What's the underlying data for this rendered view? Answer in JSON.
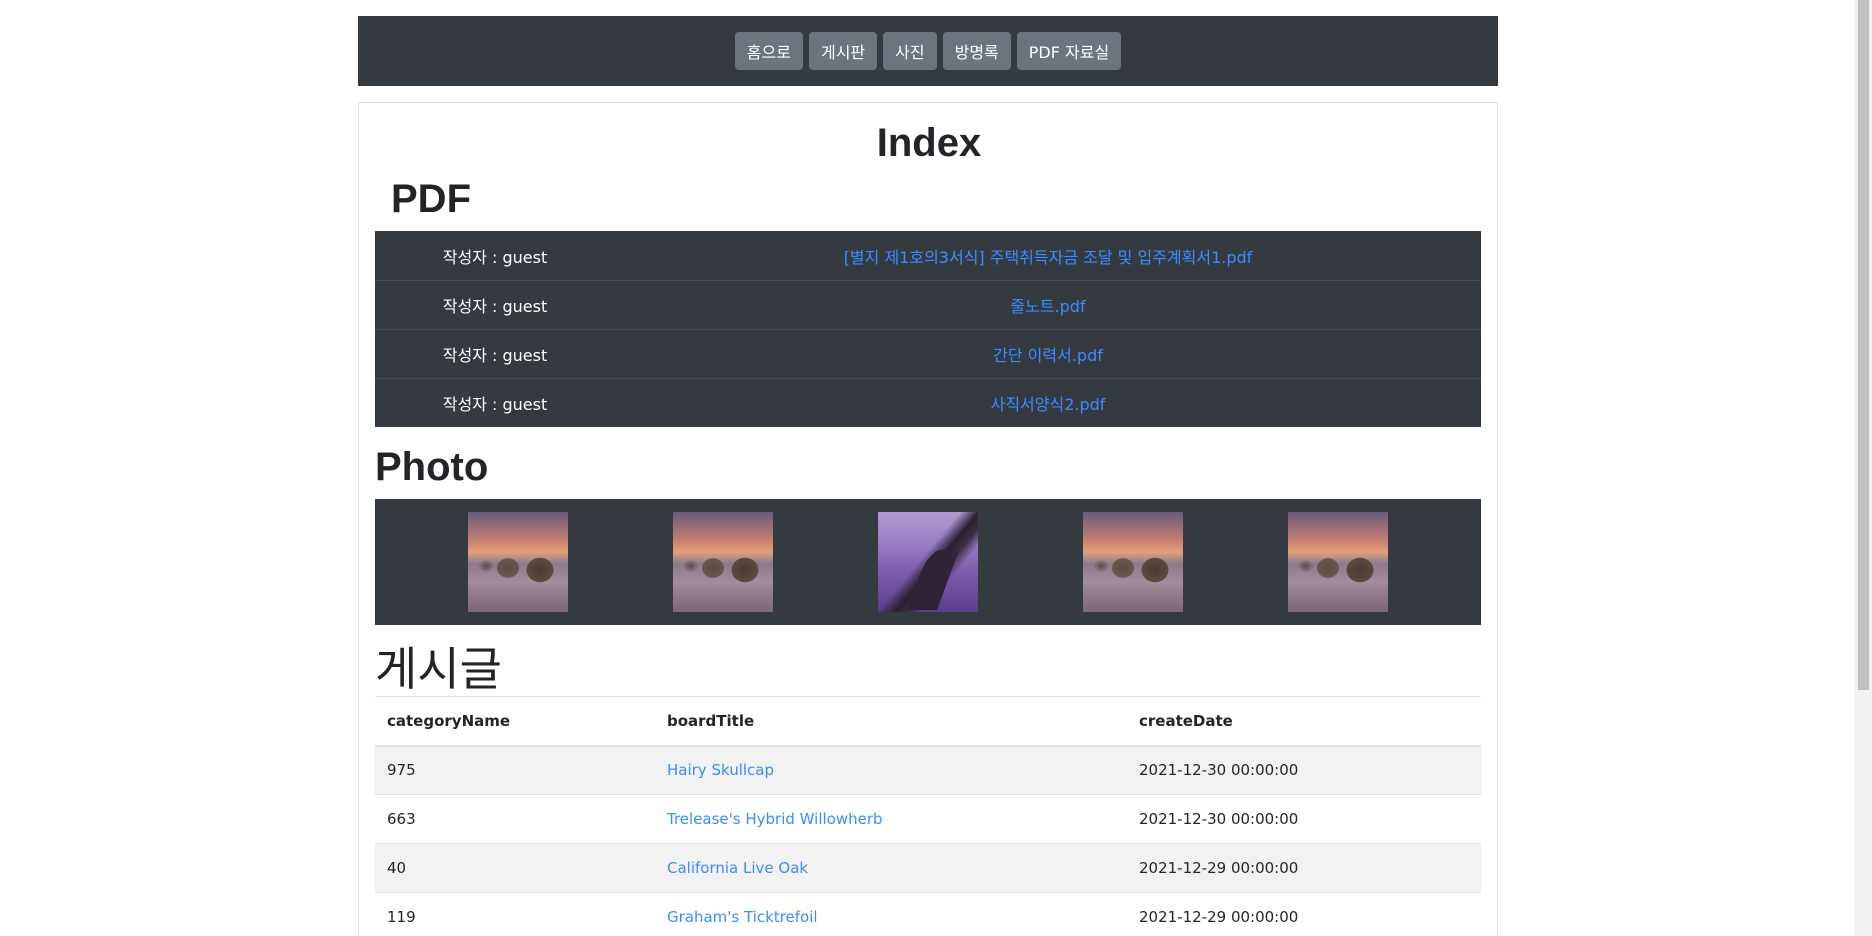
{
  "nav": {
    "items": [
      {
        "label": "홈으로"
      },
      {
        "label": "게시판"
      },
      {
        "label": "사진"
      },
      {
        "label": "방명록"
      },
      {
        "label": "PDF 자료실"
      }
    ]
  },
  "page_title": "Index",
  "pdf": {
    "heading": "PDF",
    "rows": [
      {
        "author": "작성자 : guest",
        "file": "[별지 제1호의3서식] 주택취득자금 조달 및 입주계획서1.pdf"
      },
      {
        "author": "작성자 : guest",
        "file": "줄노트.pdf"
      },
      {
        "author": "작성자 : guest",
        "file": "간단 이력서.pdf"
      },
      {
        "author": "작성자 : guest",
        "file": "사직서양식2.pdf"
      }
    ]
  },
  "photo": {
    "heading": "Photo",
    "thumbnails": [
      {
        "icon": "boulders-sunset-photo"
      },
      {
        "icon": "boulders-sunset-photo"
      },
      {
        "icon": "purple-wave-rock-photo"
      },
      {
        "icon": "boulders-sunset-photo"
      },
      {
        "icon": "boulders-sunset-photo"
      }
    ]
  },
  "posts": {
    "heading": "게시글",
    "columns": [
      "categoryName",
      "boardTitle",
      "createDate"
    ],
    "rows": [
      {
        "category": "975",
        "title": "Hairy Skullcap",
        "date": "2021-12-30 00:00:00"
      },
      {
        "category": "663",
        "title": "Trelease's Hybrid Willowherb",
        "date": "2021-12-30 00:00:00"
      },
      {
        "category": "40",
        "title": "California Live Oak",
        "date": "2021-12-29 00:00:00"
      },
      {
        "category": "119",
        "title": "Graham's Ticktrefoil",
        "date": "2021-12-29 00:00:00"
      }
    ]
  },
  "colors": {
    "navbar_bg": "#343a40",
    "nav_button_bg": "#6c757d",
    "link": "#3b8cff",
    "stripe": "#f2f2f2"
  }
}
